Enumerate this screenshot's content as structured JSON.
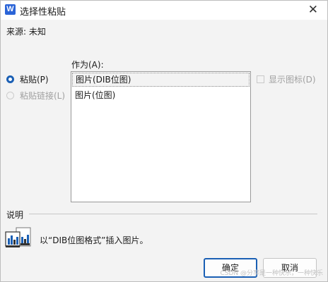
{
  "window": {
    "app_icon_letter": "W",
    "title": "选择性粘贴"
  },
  "source": {
    "label": "来源:",
    "value": "未知"
  },
  "paste_options": [
    {
      "label": "粘贴(P)",
      "selected": true,
      "enabled": true
    },
    {
      "label": "粘贴链接(L)",
      "selected": false,
      "enabled": false
    }
  ],
  "as_section": {
    "label": "作为(A):",
    "items": [
      {
        "label": "图片(DIB位图)",
        "selected": true
      },
      {
        "label": "图片(位图)",
        "selected": false
      }
    ]
  },
  "display_as_icon": {
    "label": "显示图标(D)",
    "checked": false,
    "enabled": false
  },
  "description": {
    "label": "说明",
    "text": "以“DIB位图格式”插入图片。",
    "icon": "paste-picture-icon"
  },
  "buttons": {
    "ok": "确定",
    "cancel": "取消"
  },
  "watermark": "CSDN @分享是一种快乐，一种快乐",
  "colors": {
    "accent": "#1a5fb4",
    "app_icon": "#2b64d7"
  }
}
